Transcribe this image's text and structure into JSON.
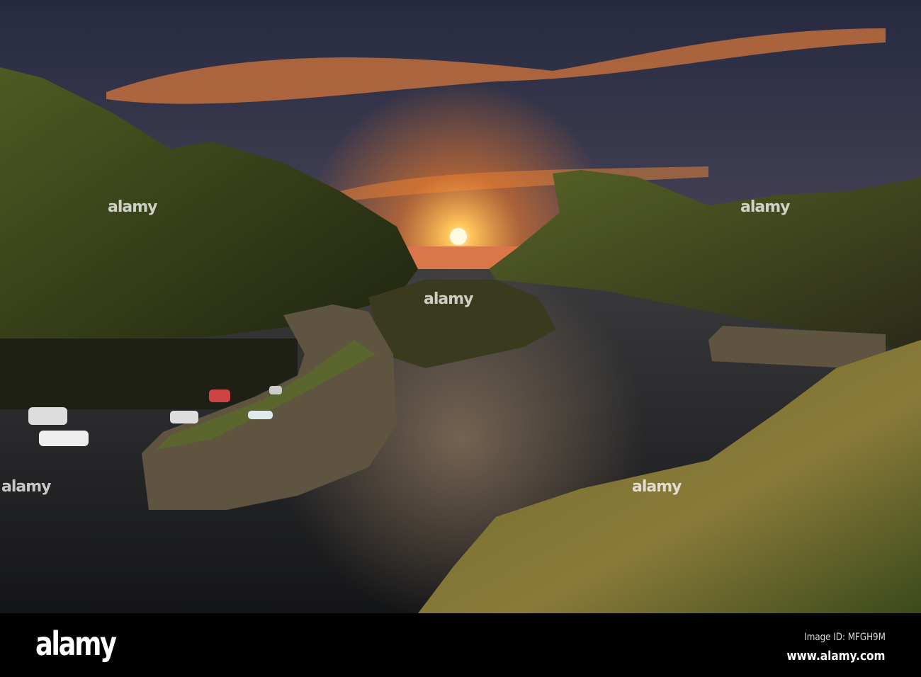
{
  "photo": {
    "subject": "Sunset over harbour inlet",
    "colors": {
      "sky_top": "#2a2e45",
      "sky_glow": "#f08a3a",
      "sun": "#fff4c0",
      "hill": "#3d4a1c",
      "water": "#1f2022",
      "wall": "#5e5440"
    }
  },
  "watermark": {
    "text": "alamy"
  },
  "footer": {
    "logo": "alamy",
    "image_id": "Image ID: MFGH9M",
    "website": "www.alamy.com"
  }
}
